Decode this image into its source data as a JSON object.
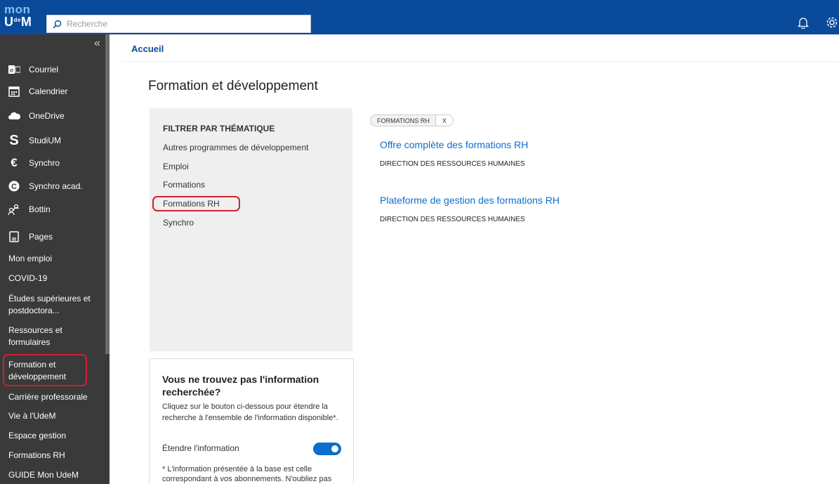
{
  "header": {
    "logo_top": "mon",
    "logo_u": "U",
    "logo_de": "de",
    "logo_m": "M",
    "search_placeholder": "Recherche"
  },
  "sidebar": {
    "icon_items": [
      {
        "label": "Courriel",
        "icon": "outlook-icon"
      },
      {
        "label": "Calendrier",
        "icon": "calendar-icon"
      },
      {
        "label": "OneDrive",
        "icon": "cloud-icon"
      },
      {
        "label": "StudiUM",
        "icon": "studium-icon"
      },
      {
        "label": "Synchro",
        "icon": "synchro-icon"
      },
      {
        "label": "Synchro acad.",
        "icon": "synchro-acad-icon"
      },
      {
        "label": "Bottin",
        "icon": "people-icon"
      },
      {
        "label": "Pages",
        "icon": "pages-icon"
      }
    ],
    "links": [
      "Mon emploi",
      "COVID-19",
      "Études supérieures et postdoctora...",
      "Ressources et formulaires",
      "Formation et développement",
      "Carrière professorale",
      "Vie à l'UdeM",
      "Espace gestion",
      "Formations RH",
      "GUIDE Mon UdeM"
    ]
  },
  "breadcrumb": "Accueil",
  "page_title": "Formation et développement",
  "filter": {
    "heading": "FILTRER PAR THÉMATIQUE",
    "items": [
      "Autres programmes de développement",
      "Emploi",
      "Formations",
      "Formations RH",
      "Synchro"
    ]
  },
  "info_box": {
    "title": "Vous ne trouvez pas l'information recherchée?",
    "description": "Cliquez sur le bouton ci-dessous pour étendre la recherche à l'ensemble de l'information disponible*.",
    "toggle_label": "Étendre l'information",
    "toggle_on": true,
    "note": "* L'information présentée à la base est celle correspondant à vos abonnements. N'oubliez pas"
  },
  "active_filter_chip": {
    "label": "FORMATIONS RH",
    "remove": "X"
  },
  "results": [
    {
      "title": "Offre complète des formations RH",
      "source": "DIRECTION DES RESSOURCES HUMAINES"
    },
    {
      "title": "Plateforme de gestion des formations RH",
      "source": "DIRECTION DES RESSOURCES HUMAINES"
    }
  ],
  "colors": {
    "header": "#0a4a9b",
    "sidebar": "#3a3a3a",
    "link": "#0a6fcf",
    "highlight": "#d21f2f"
  }
}
